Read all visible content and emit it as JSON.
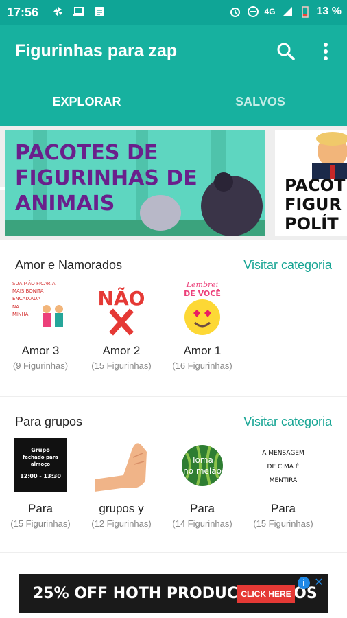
{
  "status_bar": {
    "time": "17:56",
    "network": "4G",
    "battery": "13 %"
  },
  "app_bar": {
    "title": "Figurinhas para zap",
    "search_icon": "search-icon",
    "more_icon": "more-vert-icon"
  },
  "tabs": [
    {
      "label": "EXPLORAR",
      "selected": true
    },
    {
      "label": "SALVOS",
      "selected": false
    }
  ],
  "banners": [
    {
      "text_lines": [
        "PACOTES DE",
        "FIGURINHAS DE",
        "ANIMAIS"
      ],
      "bg": "#5ed6c0",
      "text_color": "#6a1f8c"
    },
    {
      "text_lines": [
        "PACOT",
        "FIGUR",
        "POLÍT"
      ],
      "bg": "#ffffff",
      "text_color": "#111111"
    }
  ],
  "categories": [
    {
      "title": "Amor e Namorados",
      "visit_label": "Visitar categoria",
      "packs": [
        {
          "name": "Amor 3",
          "count": "(9 Figurinhas)",
          "thumb_text": [
            "SUA MÃO FICARIA",
            "MAIS BONITA",
            "ENCAIXADA",
            "NA",
            "MINHA"
          ]
        },
        {
          "name": "Amor 2",
          "count": "(15 Figurinhas)",
          "thumb_text": [
            "NÃO"
          ]
        },
        {
          "name": "Amor 1",
          "count": "(16 Figurinhas)",
          "thumb_text": [
            "Lembrei",
            "DE VOCÊ"
          ]
        }
      ]
    },
    {
      "title": "Para grupos",
      "visit_label": "Visitar categoria",
      "packs": [
        {
          "name": "Para",
          "count": "(15 Figurinhas)",
          "thumb_text": [
            "Grupo",
            "fechado para",
            "almoço",
            "12:00 - 13:30"
          ]
        },
        {
          "name": "grupos y",
          "count": "(12 Figurinhas)",
          "thumb_text": []
        },
        {
          "name": "Para",
          "count": "(14 Figurinhas)",
          "thumb_text": [
            "Toma",
            "no melão"
          ]
        },
        {
          "name": "Para",
          "count": "(15 Figurinhas)",
          "thumb_text": [
            "A MENSAGEM",
            "DE CIMA É",
            "MENTIRA"
          ]
        }
      ]
    }
  ],
  "ad": {
    "text": "25% OFF HOTH PRODUCT VIDEOS",
    "cta": "CLICK HERE",
    "info_icon": "info-icon",
    "close_icon": "close-icon"
  },
  "colors": {
    "primary": "#17b19f",
    "status_bar": "#0fa596",
    "accent_text": "#17a594"
  }
}
